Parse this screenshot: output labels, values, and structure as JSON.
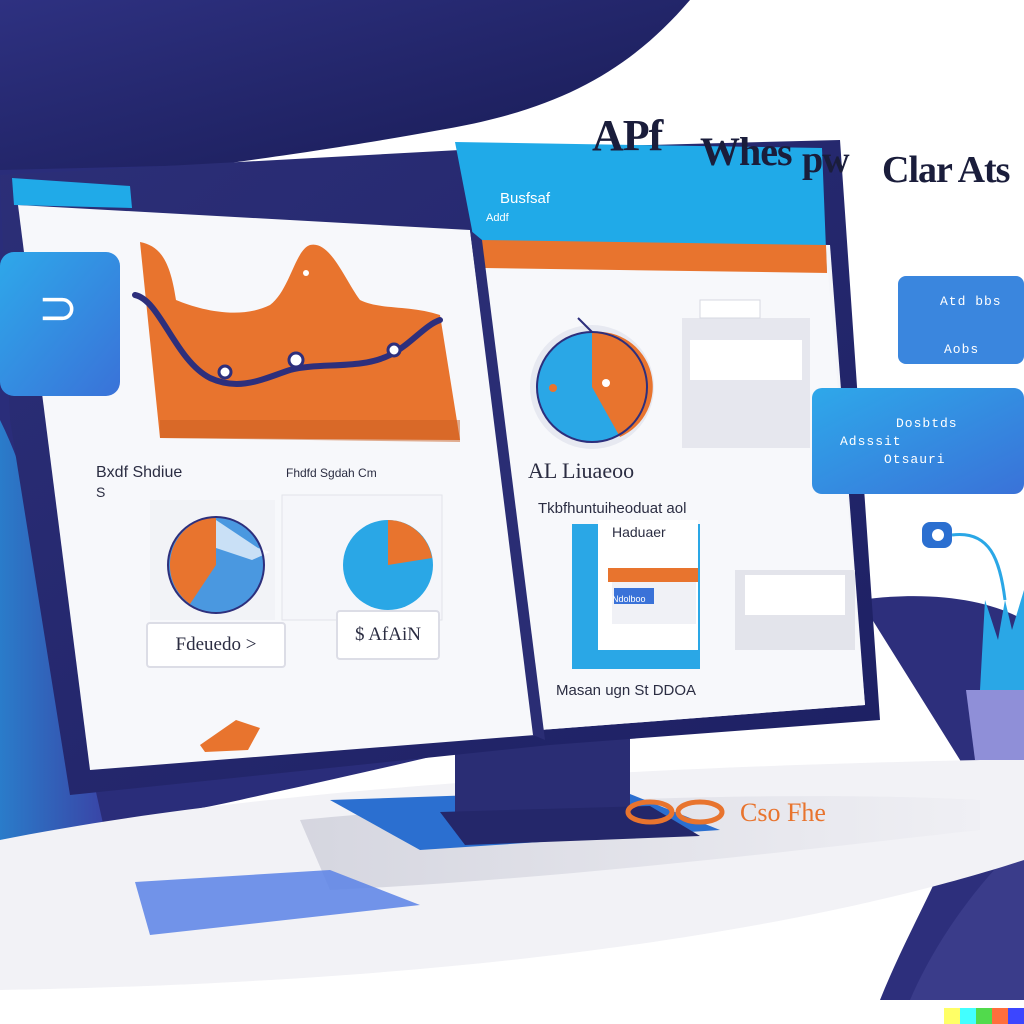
{
  "headline": {
    "line1": "APf",
    "line2": "Whes",
    "line3": "pw",
    "line4": "Clar Ats"
  },
  "left_panel": {
    "section_title": "Bxdf Shdiue",
    "section_sub": "S",
    "small_title": "Fhdfd Sgdah Cm",
    "button1_label": "Fdeuedo >",
    "button2_label": "$ AfAiN"
  },
  "right_panel": {
    "header_title": "Busfsaf",
    "header_caption": "Addf",
    "pie_caption": "AL Liuaeoo",
    "paragraph_title": "Tkbfhuntuiheoduat aol",
    "paragraph_sub": "Haduaer",
    "card_text": "Ndolboo",
    "footer_text": "Masan ugn St DDOA"
  },
  "float_cards": {
    "left_card_glyph": "⊃",
    "card_a_line1": "Atd bbs",
    "card_a_line2": "Aobs",
    "card_b_line1": "Dosbtds",
    "card_b_line2": "Adsssit",
    "card_b_line3": "Otsauri"
  },
  "desk_text": "Cso Fhe",
  "colors": {
    "navy": "#1f2360",
    "navy_dark": "#262a6e",
    "blue": "#2aa7e6",
    "orange": "#e8742e",
    "screen_bg": "#f7f8fb"
  },
  "icons": [
    "toggle-icon",
    "pin-icon",
    "plug-icon",
    "plant-pot-icon"
  ]
}
